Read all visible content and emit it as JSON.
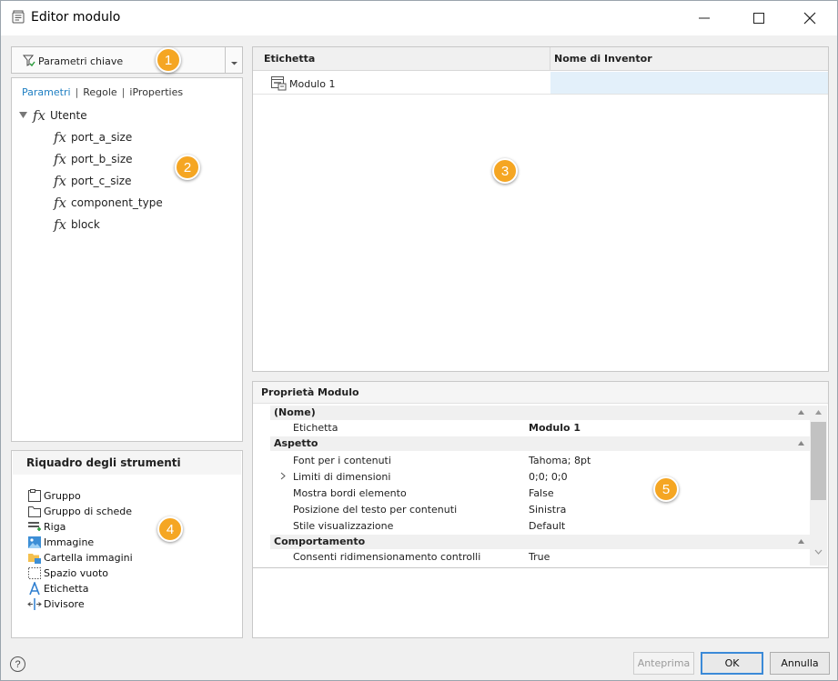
{
  "window": {
    "title": "Editor modulo"
  },
  "filter": {
    "label": "Parametri chiave"
  },
  "tree": {
    "tabs": [
      "Parametri",
      "Regole",
      "iProperties"
    ],
    "root": "Utente",
    "params": [
      "port_a_size",
      "port_b_size",
      "port_c_size",
      "component_type",
      "block"
    ]
  },
  "toolbox": {
    "title": "Riquadro degli strumenti",
    "items": [
      {
        "label": "Gruppo",
        "icon": "group-icon"
      },
      {
        "label": "Gruppo di schede",
        "icon": "tab-group-icon"
      },
      {
        "label": "Riga",
        "icon": "row-icon"
      },
      {
        "label": "Immagine",
        "icon": "image-icon"
      },
      {
        "label": "Cartella immagini",
        "icon": "image-folder-icon"
      },
      {
        "label": "Spazio vuoto",
        "icon": "empty-space-icon"
      },
      {
        "label": "Etichetta",
        "icon": "label-icon"
      },
      {
        "label": "Divisore",
        "icon": "splitter-icon"
      }
    ]
  },
  "grid": {
    "col1": "Etichetta",
    "col2": "Nome di Inventor",
    "rows": [
      {
        "label": "Modulo 1",
        "inventor_name": ""
      }
    ]
  },
  "properties": {
    "header_label": "Proprietà",
    "header_object": "Modulo",
    "categories": [
      "(Nome)",
      "Aspetto",
      "Comportamento"
    ],
    "rows": [
      {
        "name": "Etichetta",
        "value": "Modulo 1"
      },
      {
        "name": "Font per i contenuti",
        "value": "Tahoma; 8pt"
      },
      {
        "name": "Limiti di dimensioni",
        "value": "0;0; 0;0"
      },
      {
        "name": "Mostra bordi elemento",
        "value": "False"
      },
      {
        "name": "Posizione del testo per contenuti",
        "value": "Sinistra"
      },
      {
        "name": "Stile visualizzazione",
        "value": "Default"
      },
      {
        "name": "Consenti ridimensionamento controlli",
        "value": "True"
      }
    ]
  },
  "badges": [
    "1",
    "2",
    "3",
    "4",
    "5"
  ],
  "footer": {
    "help": "?",
    "preview": "Anteprima",
    "ok": "OK",
    "cancel": "Annulla"
  },
  "colors": {
    "accent": "#1d7ec2",
    "badge": "#f5a623",
    "selection": "#e3f0fa"
  }
}
